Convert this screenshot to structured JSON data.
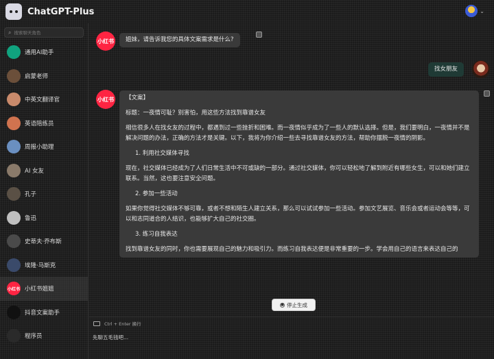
{
  "app": {
    "title": "ChatGPT-Plus"
  },
  "search": {
    "placeholder": "搜索聊天角色"
  },
  "roles": [
    {
      "label": "通用AI助手",
      "icon": "openai-icon",
      "color": "#10a37f",
      "mark": ""
    },
    {
      "label": "启蒙老师",
      "icon": "teacher-avatar",
      "color": "#6b4f3a",
      "mark": ""
    },
    {
      "label": "中英文翻译官",
      "icon": "translator-avatar",
      "color": "#c98a6b",
      "mark": ""
    },
    {
      "label": "英语陪练员",
      "icon": "english-tutor-avatar",
      "color": "#d0734f",
      "mark": ""
    },
    {
      "label": "周报小助理",
      "icon": "report-assistant-avatar",
      "color": "#6a8fc0",
      "mark": ""
    },
    {
      "label": "AI 女友",
      "icon": "ai-girlfriend-avatar",
      "color": "#8a7a6a",
      "mark": ""
    },
    {
      "label": "孔子",
      "icon": "confucius-avatar",
      "color": "#5a5045",
      "mark": ""
    },
    {
      "label": "鲁迅",
      "icon": "luxun-avatar",
      "color": "#bfbfbf",
      "mark": ""
    },
    {
      "label": "史蒂夫·乔布斯",
      "icon": "steve-jobs-avatar",
      "color": "#4a4a4a",
      "mark": ""
    },
    {
      "label": "埃隆·马斯克",
      "icon": "elon-musk-avatar",
      "color": "#3a4a6a",
      "mark": ""
    },
    {
      "label": "小红书姐姐",
      "icon": "xiaohongshu-icon",
      "color": "#ff2442",
      "mark": "小红书"
    },
    {
      "label": "抖音文案助手",
      "icon": "douyin-icon",
      "color": "#111111",
      "mark": ""
    },
    {
      "label": "程序员",
      "icon": "programmer-avatar",
      "color": "#2a2a2a",
      "mark": ""
    }
  ],
  "chat": {
    "assistant_mark": "小红书",
    "msg1": "姐妹，请告诉我您的具体文案需求是什么?",
    "msg2": "找女朋友",
    "msg3": {
      "tag": "【文案】",
      "title": "标题：一夜情可耻？别害怕，用这些方法找到靠谱女友",
      "intro": "相信很多人在找女友的过程中，都遇到过一些挫折和困难。而一夜情似乎成为了一些人的默认选择。但是，我们要明白，一夜情并不是解决问题的办法，正确的方法才是关键。以下，我将为你介绍一些去寻找靠谱女友的方法，帮助你摆脱一夜情的阴影。",
      "h1": "1. 利用社交媒体寻找",
      "p1": "现在，社交媒体已经成为了人们日常生活中不可或缺的一部分。通过社交媒体，你可以轻松地了解到附近有哪些女生，可以和她们建立联系。当然，这也要注意安全问题。",
      "h2": "2. 参加一些活动",
      "p2": "如果你觉得社交媒体不够可靠，或者不想和陌生人建立关系，那么可以试试参加一些活动。参加文艺展览、音乐会或者运动会等等，可以和志同道合的人结识，也能够扩大自己的社交圈。",
      "h3": "3. 练习自我表达",
      "p3": "找到靠谱女友的同时，你也需要展现自己的魅力和吸引力。而练习自我表达便是非常重要的一步。学会用自己的语言来表达自己的"
    },
    "stop_label": "停止生成"
  },
  "input": {
    "hint": "Ctrl + Enter 换行",
    "value": "先聊五毛钱吧..."
  }
}
